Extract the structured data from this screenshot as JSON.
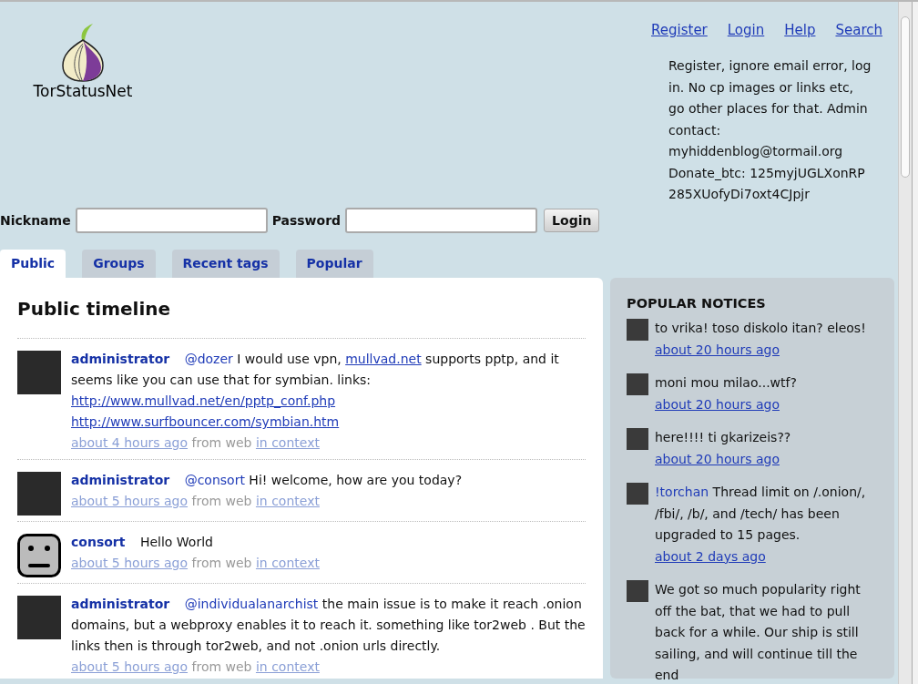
{
  "logo": {
    "text": "TorStatusNet"
  },
  "nav": [
    "Register",
    "Login",
    "Help",
    "Search"
  ],
  "site_notice": [
    "Register, ignore email error, log in. No cp images or links etc, go other places for that. Admin contact:",
    "myhiddenblog@tormail.org",
    "Donate_btc: 125myjUGLXonRP285XUofyDi7oxt4CJpjr"
  ],
  "login_form": {
    "nickname_label": "Nickname",
    "password_label": "Password",
    "button": "Login"
  },
  "tabs": [
    {
      "label": "Public",
      "selected": true
    },
    {
      "label": "Groups",
      "selected": false
    },
    {
      "label": "Recent tags",
      "selected": false
    },
    {
      "label": "Popular",
      "selected": false
    }
  ],
  "timeline": {
    "title": "Public timeline",
    "notices": [
      {
        "author": "administrator",
        "kind": "photo",
        "parts": [
          {
            "kind": "mention",
            "text": "@dozer"
          },
          {
            "kind": "text",
            "text": " I would use vpn, "
          },
          {
            "kind": "link",
            "text": "mullvad.net"
          },
          {
            "kind": "text",
            "text": " supports pptp, and it seems like you can use that for symbian. links: "
          },
          {
            "kind": "link",
            "text": "http://www.mullvad.net/en/pptp_conf.php"
          },
          {
            "kind": "link",
            "text": "http://www.surfbouncer.com/symbian.htm"
          }
        ],
        "time": "about 4 hours ago",
        "source": "from web",
        "context": "in context"
      },
      {
        "author": "administrator",
        "kind": "photo",
        "parts": [
          {
            "kind": "mention",
            "text": "@consort"
          },
          {
            "kind": "text",
            "text": " Hi! welcome, how are you today?"
          }
        ],
        "time": "about 5 hours ago",
        "source": "from web",
        "context": "in context"
      },
      {
        "author": "consort",
        "kind": "default",
        "parts": [
          {
            "kind": "text",
            "text": "Hello World"
          }
        ],
        "time": "about 5 hours ago",
        "source": "from web",
        "context": "in context"
      },
      {
        "author": "administrator",
        "kind": "photo",
        "parts": [
          {
            "kind": "mention",
            "text": "@individualanarchist"
          },
          {
            "kind": "text",
            "text": " the main issue is to make it reach .onion domains, but a webproxy enables it to reach it. something like tor2web . But the links then is through tor2web, and not .onion urls directly."
          }
        ],
        "time": "about 5 hours ago",
        "source": "from web",
        "context": "in context"
      }
    ]
  },
  "popular_notices": {
    "title": "POPULAR NOTICES",
    "notices": [
      {
        "parts": [
          {
            "kind": "text",
            "text": "to vrika! toso diskolo itan? eleos!"
          }
        ],
        "time": "about 20 hours ago"
      },
      {
        "parts": [
          {
            "kind": "text",
            "text": "moni mou milao...wtf?"
          }
        ],
        "time": "about 20 hours ago"
      },
      {
        "parts": [
          {
            "kind": "text",
            "text": "here!!!! ti gkarizeis??"
          }
        ],
        "time": "about 20 hours ago"
      },
      {
        "parts": [
          {
            "kind": "mention",
            "text": "!torchan"
          },
          {
            "kind": "text",
            "text": " Thread limit on /.onion/, /fbi/, /b/, and /tech/ has been upgraded to 15 pages."
          }
        ],
        "time": "about 2 days ago"
      },
      {
        "parts": [
          {
            "kind": "text",
            "text": "We got so much popularity right off the bat, that we had to pull back for a while. Our ship is still sailing, and will continue till the end"
          }
        ]
      }
    ]
  }
}
